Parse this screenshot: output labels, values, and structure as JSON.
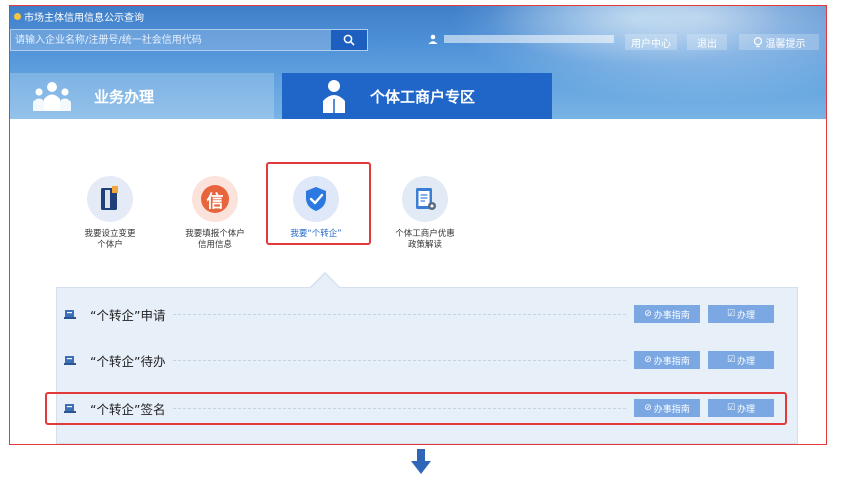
{
  "header": {
    "site_title": "市场主体信用信息公示查询",
    "search": {
      "placeholder": "请输入企业名称/注册号/统一社会信用代码",
      "button_icon": "search-icon"
    },
    "links": {
      "user_center": "用户中心",
      "logout": "退出",
      "tips": "温馨提示"
    }
  },
  "tabs": [
    {
      "label": "业务办理",
      "icon": "people-group-icon",
      "active": false
    },
    {
      "label": "个体工商户专区",
      "icon": "person-icon",
      "active": true
    }
  ],
  "services": [
    {
      "label_line1": "我要设立变更",
      "label_line2": "个体户",
      "icon": "folder-binder-icon",
      "color": "#1f66c8"
    },
    {
      "label_line1": "我要填报个体户",
      "label_line2": "信用信息",
      "icon": "credit-xin-icon",
      "glyph": "信",
      "color": "#e8643c"
    },
    {
      "label_line1": "我要“个转企”",
      "label_line2": "",
      "icon": "shield-check-icon",
      "color": "#2a78e0"
    },
    {
      "label_line1": "个体工商户优惠",
      "label_line2": "政策解读",
      "icon": "policy-document-icon",
      "color": "#3b7fd4"
    }
  ],
  "rows": [
    {
      "title": "“个转企”申请",
      "guide_label": "办事指南",
      "handle_label": "办理"
    },
    {
      "title": "“个转企”待办",
      "guide_label": "办事指南",
      "handle_label": "办理"
    },
    {
      "title": "“个转企”签名",
      "guide_label": "办事指南",
      "handle_label": "办理"
    }
  ],
  "colors": {
    "accent": "#1f66c8",
    "highlight": "#e23a3a",
    "button": "#7ba8e3"
  }
}
